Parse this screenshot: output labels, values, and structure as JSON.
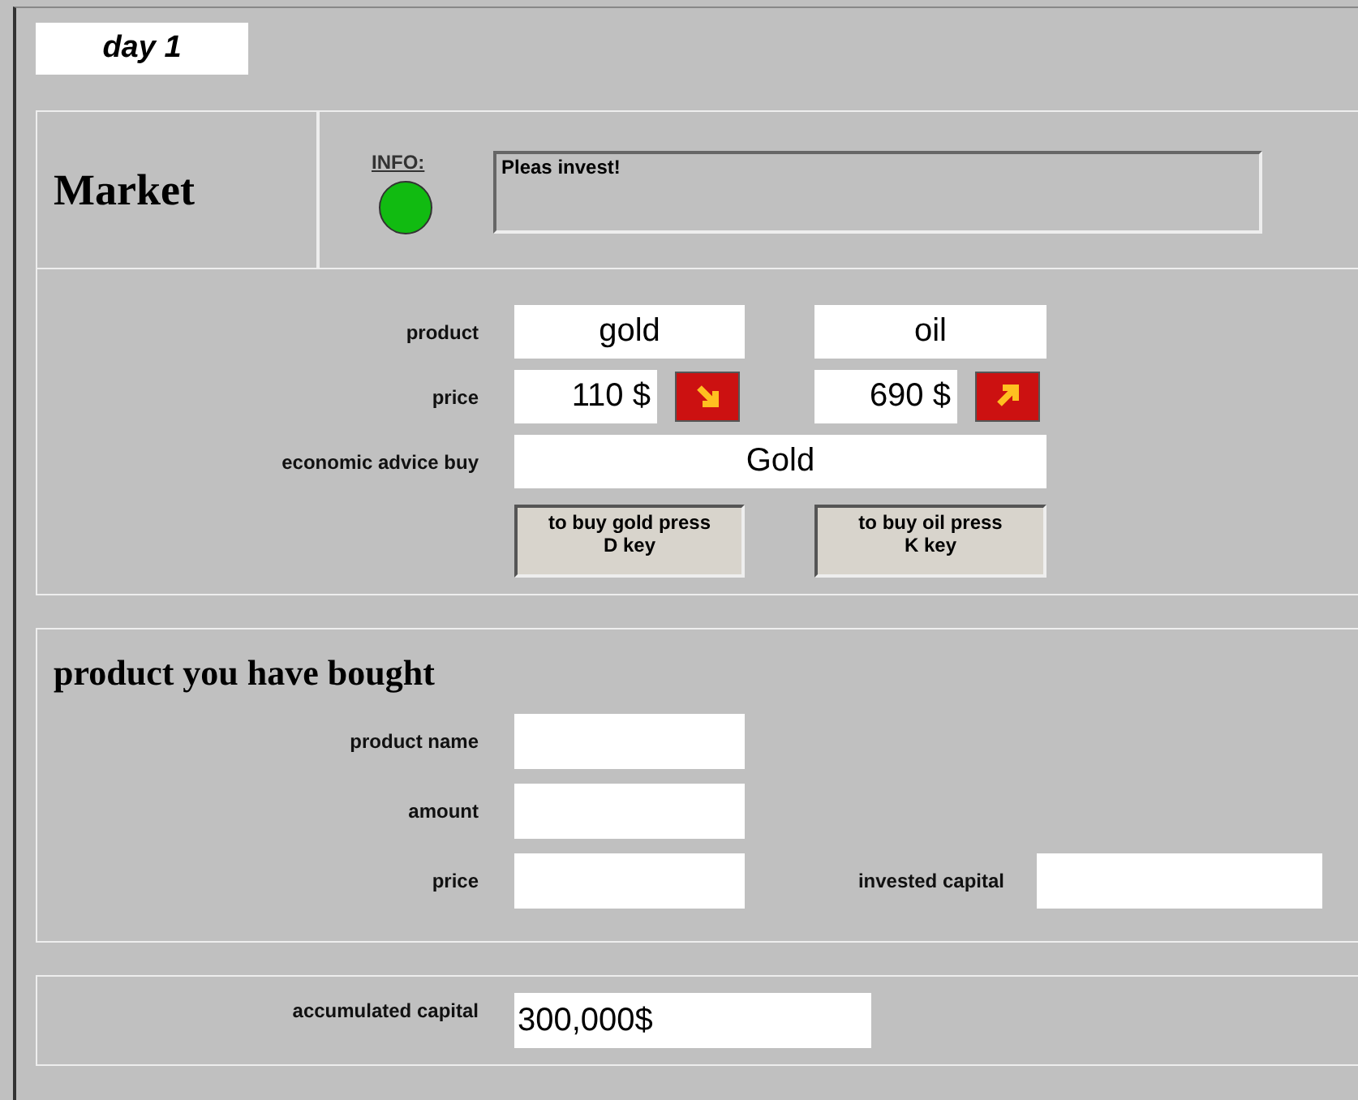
{
  "day": "day 1",
  "market": {
    "title": "Market",
    "info_label": "INFO:",
    "message": "Pleas invest!"
  },
  "offer": {
    "product_label": "product",
    "price_label": "price",
    "advice_label": "economic advice buy",
    "advice": "Gold",
    "products": [
      {
        "name": "gold",
        "price": "110 $",
        "rising": false,
        "hint": [
          "to buy gold press",
          "D key"
        ]
      },
      {
        "name": "oil",
        "price": "690 $",
        "rising": true,
        "hint": [
          "to buy oil press",
          "K key"
        ]
      }
    ]
  },
  "bought": {
    "title": "product you have bought",
    "product_name_label": "product name",
    "amount_label": "amount",
    "price_label": "price",
    "invested_label": "invested capital"
  },
  "capital": {
    "label": "accumulated capital",
    "value": "300,000$"
  }
}
